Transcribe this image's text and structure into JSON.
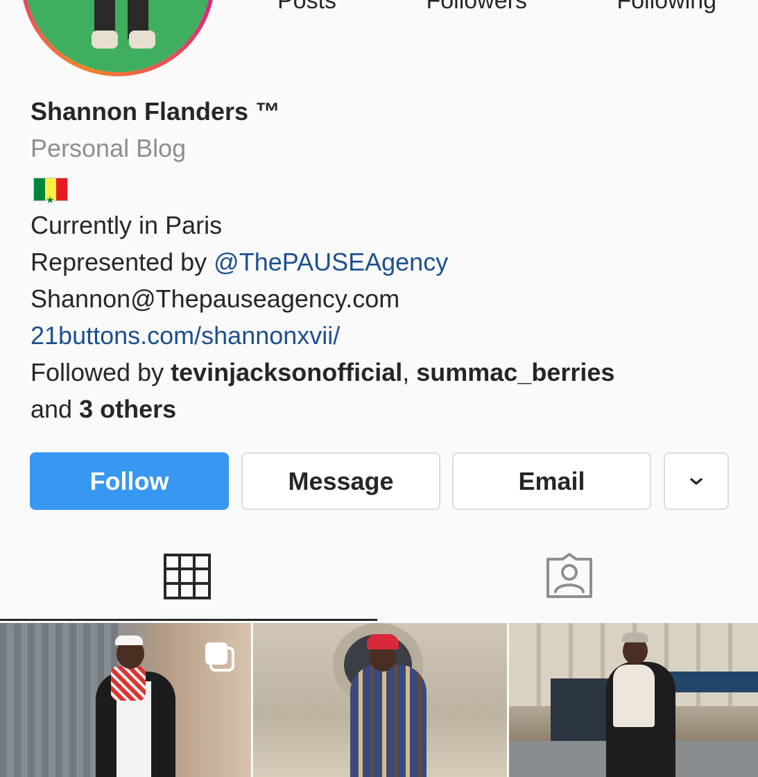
{
  "stats": {
    "posts_label": "Posts",
    "followers_label": "Followers",
    "following_label": "Following"
  },
  "profile": {
    "name": "Shannon Flanders ™",
    "category": "Personal Blog",
    "flag_icon": "senegal-flag-icon",
    "bio_line1": "Currently in Paris",
    "bio_line2_prefix": "Represented by ",
    "bio_line2_mention": "@ThePAUSEAgency",
    "bio_email": "Shannon@Thepauseagency.com",
    "website": "21buttons.com/shannonxvii/",
    "followed_by_prefix": "Followed by ",
    "followed_user1": "tevinjacksonofficial",
    "followed_sep": ", ",
    "followed_user2": "summac_berries",
    "followed_and": "and ",
    "followed_others": "3 others"
  },
  "buttons": {
    "follow": "Follow",
    "message": "Message",
    "email": "Email",
    "more_icon": "chevron-down-icon"
  },
  "tabs": [
    {
      "icon": "grid-icon",
      "active": true
    },
    {
      "icon": "tagged-person-icon",
      "active": false
    }
  ],
  "colors": {
    "follow_button": "#3897f0",
    "link": "#1d4f8f",
    "secondary_text": "#8e8e8e",
    "background": "#fafafa"
  },
  "grid_posts": [
    {
      "description": "photo-post-1",
      "multi_photo_icon": "carousel-icon"
    },
    {
      "description": "photo-post-2"
    },
    {
      "description": "photo-post-3"
    }
  ]
}
